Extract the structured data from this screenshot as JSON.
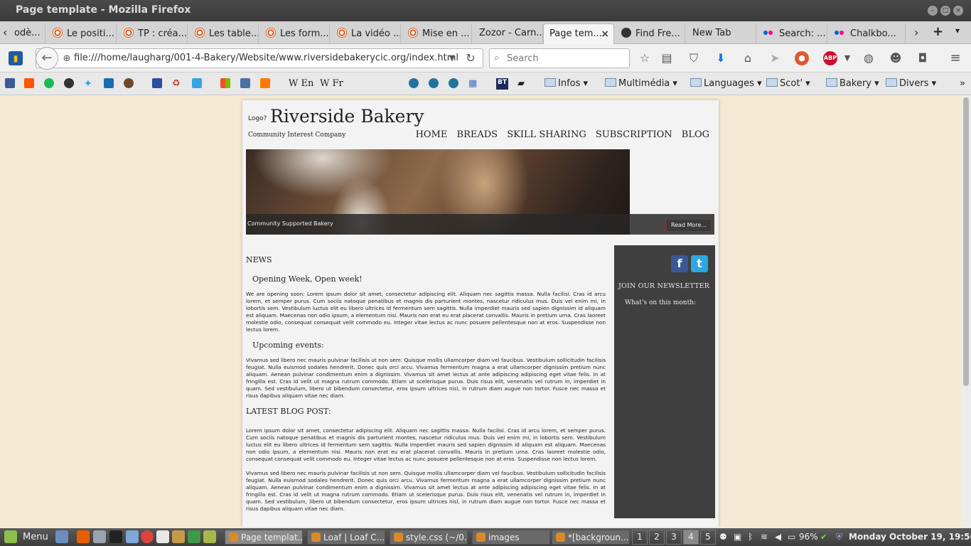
{
  "window": {
    "title": "Page template - Mozilla Firefox"
  },
  "tabs": [
    {
      "label": "odè..."
    },
    {
      "label": "Le positi..."
    },
    {
      "label": "TP : créa..."
    },
    {
      "label": "Les table..."
    },
    {
      "label": "Les form..."
    },
    {
      "label": "La vidéo ..."
    },
    {
      "label": "Mise en ..."
    },
    {
      "label": "Zozor - Carn..."
    },
    {
      "label": "Page tem..."
    },
    {
      "label": "Find Fre..."
    },
    {
      "label": "New Tab"
    },
    {
      "label": "Search: ..."
    },
    {
      "label": "Chalkbo..."
    }
  ],
  "navbar": {
    "url": "file:///home/laugharg/001-4-Bakery/Website/www.riversidebakerycic.org/index.html",
    "search_placeholder": "Search"
  },
  "bookmarks": {
    "wiki_en": "En",
    "wiki_fr": "Fr",
    "bt": "BT",
    "folders": [
      "Infos",
      "Multimédia",
      "Languages",
      "Scot'",
      "Bakery",
      "Divers"
    ]
  },
  "site": {
    "logo": "Logo?",
    "title": "Riverside Bakery",
    "tagline": "Community Interest Company",
    "nav": [
      "HOME",
      "BREADS",
      "SKILL SHARING",
      "SUBSCRIPTION",
      "BLOG"
    ],
    "hero_caption": "Community Supported Bakery",
    "read_more": "Read More...",
    "news_heading": "NEWS",
    "news_title": "Opening Week, Open week!",
    "news_text": "We are opening soon: Lorem ipsum dolor sit amet, consectetur adipiscing elit. Aliquam nec sagittis massa. Nulla facilisi. Cras id arcu lorem, et semper purus. Cum sociis natoque penatibus et magnis dis parturient montes, nascetur ridiculus mus. Duis vel enim mi, in lobortis sem. Vestibulum luctus elit eu libero ultrices id fermentum sem sagittis. Nulla imperdiet mauris sed sapien dignissim id aliquam est aliquam. Maecenas non odio ipsum, a elementum nisi. Mauris non erat eu erat placerat convallis. Mauris in pretium urna. Cras laoreet molestie odio, consequat consequat velit commodo eu. Integer vitae lectus ac nunc posuere pellentesque non at eros. Suspendisse non lectus lorem.",
    "events_title": "Upcoming events:",
    "events_text": "Vivamus sed libero nec mauris pulvinar facilisis ut non sem. Quisque mollis ullamcorper diam vel faucibus. Vestibulum sollicitudin facilisis feugiat. Nulla euismod sodales hendrerit. Donec quis orci arcu. Vivamus fermentum magna a erat ullamcorper dignissim pretium nunc aliquam. Aenean pulvinar condimentum enim a dignissim. Vivamus sit amet lectus at ante adipiscing adipiscing eget vitae felis. In at fringilla est. Cras id velit ut magna rutrum commodo. Etiam ut scelerisque purus. Duis risus elit, venenatis vel rutrum in, imperdiet in quam. Sed vestibulum, libero ut bibendum consectetur, eros ipsum ultrices nisl, in rutrum diam augue non tortor. Fusce nec massa et risus dapibus aliquam vitae nec diam.",
    "latest_heading": "LATEST BLOG POST:",
    "blog_text_1": "Lorem ipsum dolor sit amet, consectetur adipiscing elit. Aliquam nec sagittis massa. Nulla facilisi. Cras id arcu lorem, et semper purus. Cum sociis natoque penatibus et magnis dis parturient montes, nascetur ridiculus mus. Duis vel enim mi, in lobortis sem. Vestibulum luctus elit eu libero ultrices id fermentum sem sagittis. Nulla imperdiet mauris sed sapien dignissim id aliquam est aliquam. Maecenas non odio ipsum, a elementum nisi. Mauris non erat eu erat placerat convallis. Mauris in pretium urna. Cras laoreet molestie odio, consequat consequat velit commodo eu. Integer vitae lectus ac nunc posuere pellentesque non at eros. Suspendisse non lectus lorem.",
    "blog_text_2": "Vivamus sed libero nec mauris pulvinar facilisis ut non sem. Quisque mollis ullamcorper diam vel faucibus. Vestibulum sollicitudin facilisis feugiat. Nulla euismod sodales hendrerit. Donec quis orci arcu. Vivamus fermentum magna a erat ullamcorper dignissim pretium nunc aliquam. Aenean pulvinar condimentum enim a dignissim. Vivamus sit amet lectus at ante adipiscing adipiscing eget vitae felis. In at fringilla est. Cras id velit ut magna rutrum commodo. Etiam ut scelerisque purus. Duis risus elit, venenatis vel rutrum in, imperdiet in quam. Sed vestibulum, libero ut bibendum consectetur, eros ipsum ultrices nisl, in rutrum diam augue non tortor. Fusce nec massa et risus dapibus aliquam vitae nec diam.",
    "newsletter_heading": "JOIN OUR NEWSLETTER",
    "newsletter_sub": "What's on this month:"
  },
  "taskbar": {
    "menu": "Menu",
    "windows": [
      "Page templat...",
      "Loaf | Loaf C...",
      "style.css (~/0...",
      "images",
      "*[backgroun..."
    ],
    "workspaces": [
      "1",
      "2",
      "3",
      "4",
      "5"
    ],
    "battery": "96%",
    "clock": "Monday October 19, 19:56"
  },
  "colors": {
    "page_bg": "#f4e9d3",
    "sidebar": "#3f3f3f",
    "read_more_border": "#8d2d2d"
  }
}
